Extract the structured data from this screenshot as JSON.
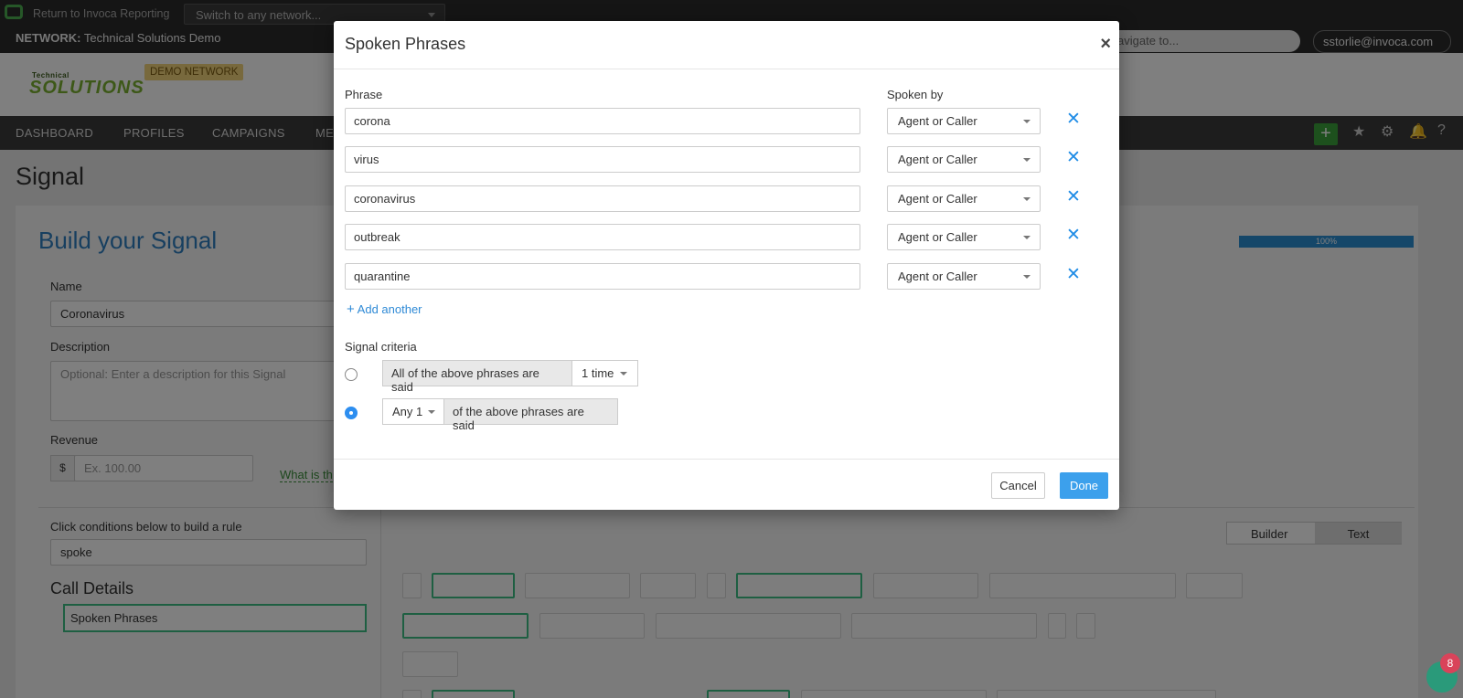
{
  "topbar": {
    "return_link": "Return to Invoca Reporting",
    "network_switch_placeholder": "Switch to any network...",
    "network_label_prefix": "NETWORK:",
    "network_name": "Technical Solutions Demo",
    "search_placeholder": "avigate to...",
    "user": "sstorlie@invoca.com ▾"
  },
  "brand": {
    "logo_small": "Technical",
    "logo_big": "SOLUTIONS",
    "badge": "DEMO NETWORK"
  },
  "nav": {
    "items": [
      "DASHBOARD",
      "PROFILES",
      "CAMPAIGNS",
      "ME"
    ],
    "plus": "+"
  },
  "page": {
    "title": "Signal",
    "build_title": "Build your Signal",
    "progress": "100%",
    "name_label": "Name",
    "name_value": "Coronavirus",
    "description_label": "Description",
    "description_placeholder": "Optional: Enter a description for this Signal",
    "revenue_label": "Revenue",
    "currency": "$",
    "revenue_placeholder": "Ex. 100.00",
    "what_link": "What is th",
    "conditions_label": "Click conditions below to build a rule",
    "conditions_search": "spoke",
    "call_details": "Call Details",
    "spoken_phrases_item": "Spoken Phrases",
    "toggle_builder": "Builder",
    "toggle_text": "Text"
  },
  "modal": {
    "title": "Spoken Phrases",
    "close": "×",
    "phrase_col": "Phrase",
    "spoken_by_col": "Spoken by",
    "phrases": [
      {
        "phrase": "corona",
        "spoken_by": "Agent or Caller"
      },
      {
        "phrase": "virus",
        "spoken_by": "Agent or Caller"
      },
      {
        "phrase": "coronavirus",
        "spoken_by": "Agent or Caller"
      },
      {
        "phrase": "outbreak",
        "spoken_by": "Agent or Caller"
      },
      {
        "phrase": "quarantine",
        "spoken_by": "Agent or Caller"
      }
    ],
    "remove_icon": "✕",
    "add_another": "Add another",
    "criteria_label": "Signal criteria",
    "criteria_all_text": "All of the above phrases are said",
    "criteria_all_select": "1 time",
    "criteria_any_select": "Any 1",
    "criteria_any_text": "of the above phrases are said",
    "selected_criteria": "any",
    "cancel": "Cancel",
    "done": "Done"
  },
  "chat": {
    "badge_count": "8"
  },
  "colors": {
    "accent": "#3ca0ec",
    "link": "#2f8ad6",
    "brand_green": "#7ab030",
    "selected_border": "#3cbf85"
  }
}
